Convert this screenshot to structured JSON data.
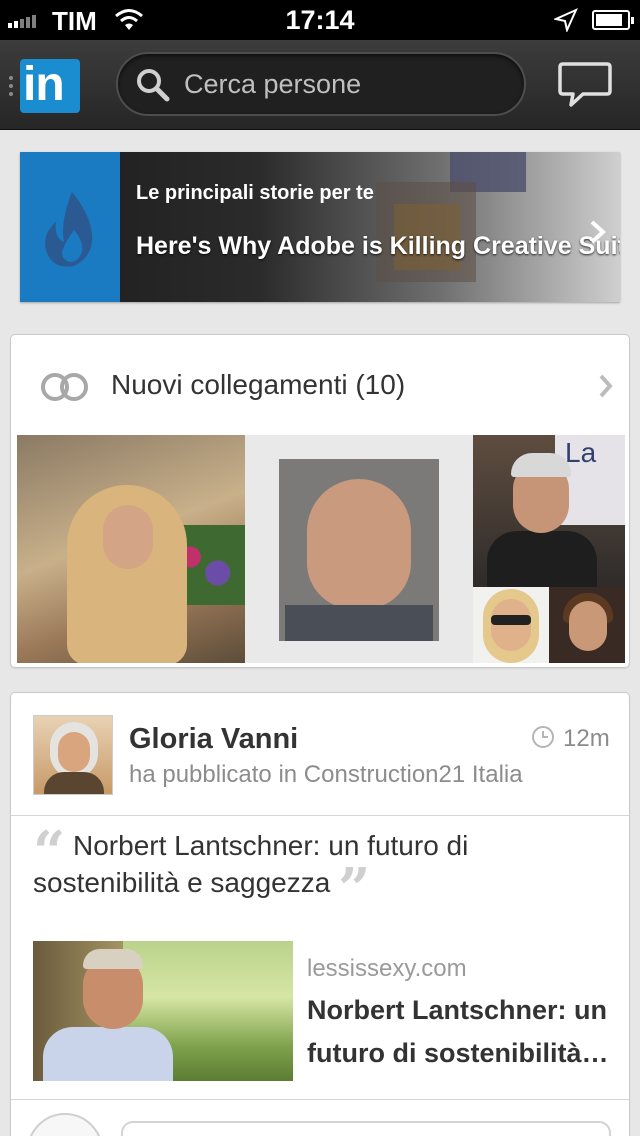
{
  "status_bar": {
    "carrier": "TIM",
    "time": "17:14",
    "battery_level": 0.85
  },
  "nav": {
    "logo_text": "in",
    "search": {
      "placeholder": "Cerca persone"
    }
  },
  "news": {
    "kicker": "Le principali storie per te",
    "headline": "Here's Why Adobe is Killing Creative Suite"
  },
  "connections": {
    "title": "Nuovi collegamenti (10)",
    "photo_sign_text": "La"
  },
  "post": {
    "author": "Gloria Vanni",
    "meta": "ha pubblicato in Construction21 Italia",
    "time_ago": "12m",
    "quote_open": "“",
    "quote": "Norbert Lantschner: un futuro di sostenibilità e saggezza",
    "quote_close": "”",
    "link": {
      "domain": "lessissexy.com",
      "title": "Norbert Lantschner: un futuro di sostenibilità…"
    }
  },
  "colors": {
    "brand": "#1a8dd1",
    "nav_bg": "#2f2f2f",
    "page_bg": "#e7e7e7"
  },
  "icons": [
    "signal-icon",
    "wifi-icon",
    "location-icon",
    "battery-icon",
    "search-icon",
    "messages-icon",
    "chevron-right-icon",
    "connections-rings-icon",
    "clock-icon"
  ]
}
